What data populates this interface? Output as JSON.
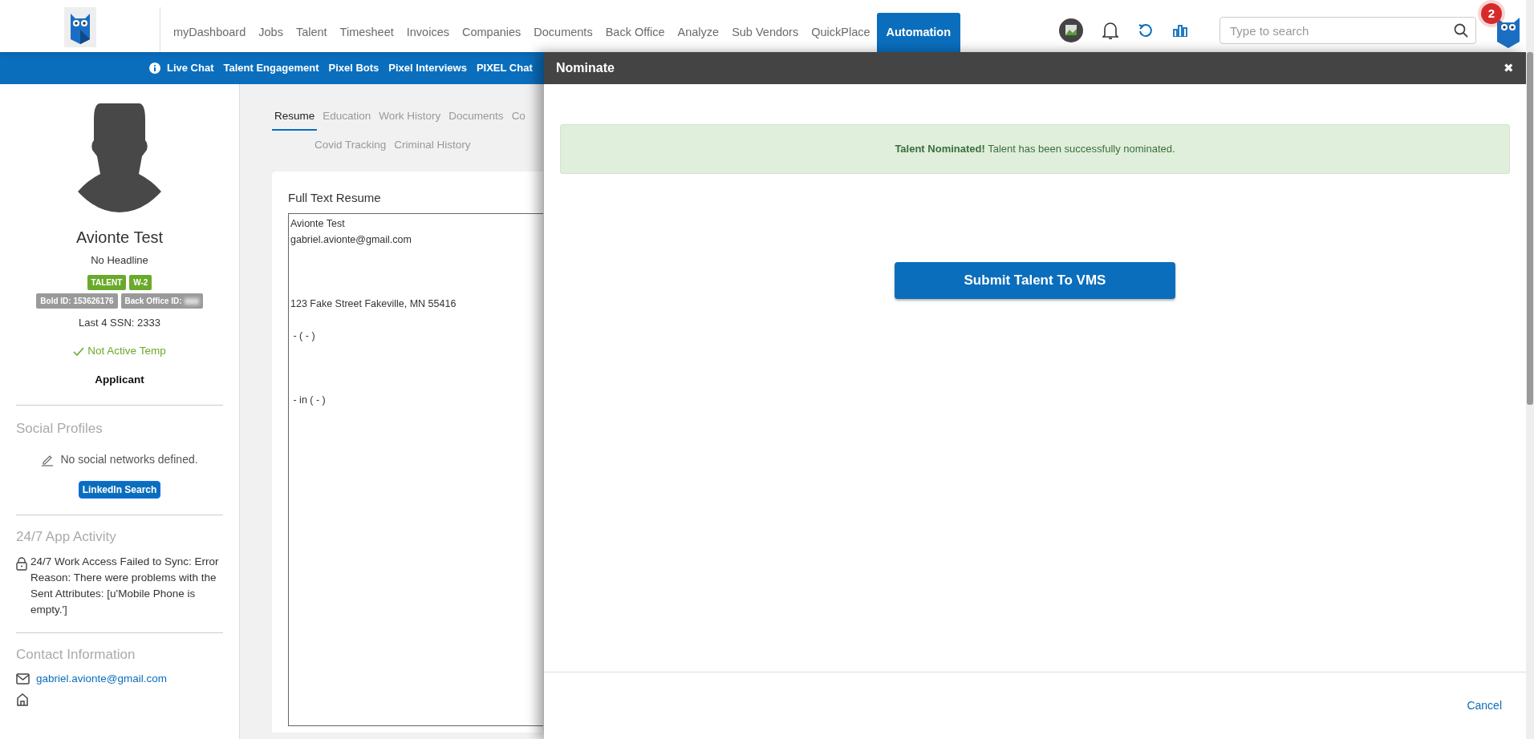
{
  "top_nav": {
    "items": [
      {
        "label": "myDashboard",
        "selected": false
      },
      {
        "label": "Jobs",
        "selected": false
      },
      {
        "label": "Talent",
        "selected": false
      },
      {
        "label": "Timesheet",
        "selected": false
      },
      {
        "label": "Invoices",
        "selected": false
      },
      {
        "label": "Companies",
        "selected": false
      },
      {
        "label": "Documents",
        "selected": false
      },
      {
        "label": "Back Office",
        "selected": false
      },
      {
        "label": "Analyze",
        "selected": false
      },
      {
        "label": "Sub Vendors",
        "selected": false
      },
      {
        "label": "QuickPlace",
        "selected": false
      },
      {
        "label": "Automation",
        "selected": true
      }
    ],
    "search": {
      "placeholder": "Type to search"
    },
    "notification_count": "2"
  },
  "sub_nav": {
    "items": [
      "Live Chat",
      "Talent Engagement",
      "Pixel Bots",
      "Pixel Interviews",
      "PIXEL Chat"
    ]
  },
  "profile": {
    "name": "Avionte Test",
    "headline": "No Headline",
    "tags": [
      "TALENT",
      "W-2"
    ],
    "ids": [
      {
        "label": "Bold ID: 153626176",
        "redacted": false
      },
      {
        "label": "Back Office ID:",
        "redacted": true
      }
    ],
    "ssn": "Last 4 SSN: 2333",
    "status": "Not Active Temp",
    "type": "Applicant"
  },
  "social": {
    "title": "Social Profiles",
    "empty": "No social networks defined.",
    "button": "LinkedIn Search"
  },
  "app_activity": {
    "title": "24/7 App Activity",
    "message": "24/7 Work Access Failed to Sync: Error Reason: There were problems with the Sent Attributes: [u'Mobile Phone is empty.']"
  },
  "contact": {
    "title": "Contact Information",
    "email": "gabriel.avionte@gmail.com"
  },
  "tabs": [
    {
      "label": "Resume",
      "selected": true
    },
    {
      "label": "Education",
      "selected": false
    },
    {
      "label": "Work History",
      "selected": false
    },
    {
      "label": "Documents",
      "selected": false
    },
    {
      "label": "Co",
      "selected": false
    },
    {
      "label": "Covid Tracking",
      "selected": false
    },
    {
      "label": "Criminal History",
      "selected": false
    }
  ],
  "resume": {
    "title": "Full Text Resume",
    "text": "Avionte Test\ngabriel.avionte@gmail.com\n\n\n\n123 Fake Street Fakeville, MN 55416\n\n - ( - )\n\n\n\n - in ( - )"
  },
  "modal": {
    "title": "Nominate",
    "close": "✖",
    "alert": "**Talent Nominated!** Talent has been successfully nominated.",
    "submit": "Submit Talent To VMS",
    "cancel": "Cancel"
  }
}
